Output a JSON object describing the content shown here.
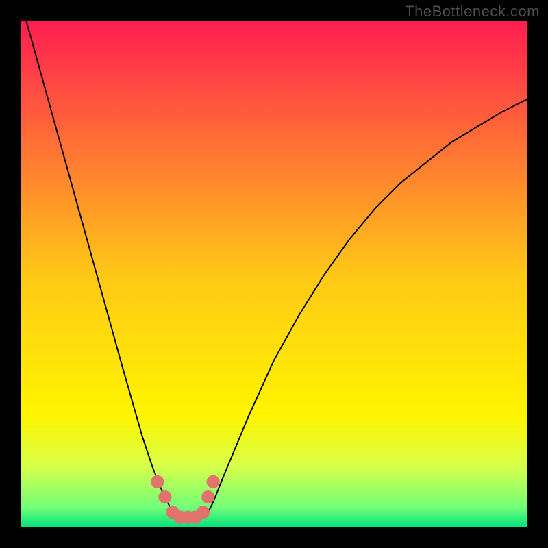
{
  "watermark": "TheBottleneck.com",
  "chart_data": {
    "type": "line",
    "title": "",
    "xlabel": "",
    "ylabel": "",
    "xlim": [
      0,
      100
    ],
    "ylim": [
      0,
      100
    ],
    "grid": false,
    "background_gradient": {
      "stops": [
        {
          "offset": 0.0,
          "color": "#ff1d51"
        },
        {
          "offset": 0.5,
          "color": "#ffc717"
        },
        {
          "offset": 0.78,
          "color": "#fff500"
        },
        {
          "offset": 0.88,
          "color": "#d6ff4a"
        },
        {
          "offset": 0.96,
          "color": "#73ff79"
        },
        {
          "offset": 1.0,
          "color": "#00e27a"
        }
      ]
    },
    "series": [
      {
        "name": "bottleneck-curve",
        "color": "#000000",
        "x": [
          0,
          5,
          10,
          15,
          20,
          22,
          24,
          26,
          28,
          30,
          31,
          32,
          33,
          34,
          35,
          36,
          37,
          38,
          40,
          45,
          50,
          55,
          60,
          65,
          70,
          75,
          80,
          85,
          90,
          95,
          100
        ],
        "y": [
          104,
          86,
          68,
          50,
          32,
          25,
          18,
          12,
          7,
          3,
          2,
          1.2,
          1,
          1,
          1.2,
          2,
          3,
          5,
          10,
          22,
          33,
          42,
          50,
          57,
          63,
          68,
          72,
          76,
          79,
          82,
          84.5
        ]
      },
      {
        "name": "bottleneck-markers",
        "color": "#e0746d",
        "marker": true,
        "x": [
          27,
          28.5,
          30,
          31.5,
          33,
          34.5,
          36,
          37,
          38
        ],
        "y": [
          9,
          6,
          3,
          2,
          2,
          2,
          3,
          6,
          9
        ]
      }
    ]
  }
}
